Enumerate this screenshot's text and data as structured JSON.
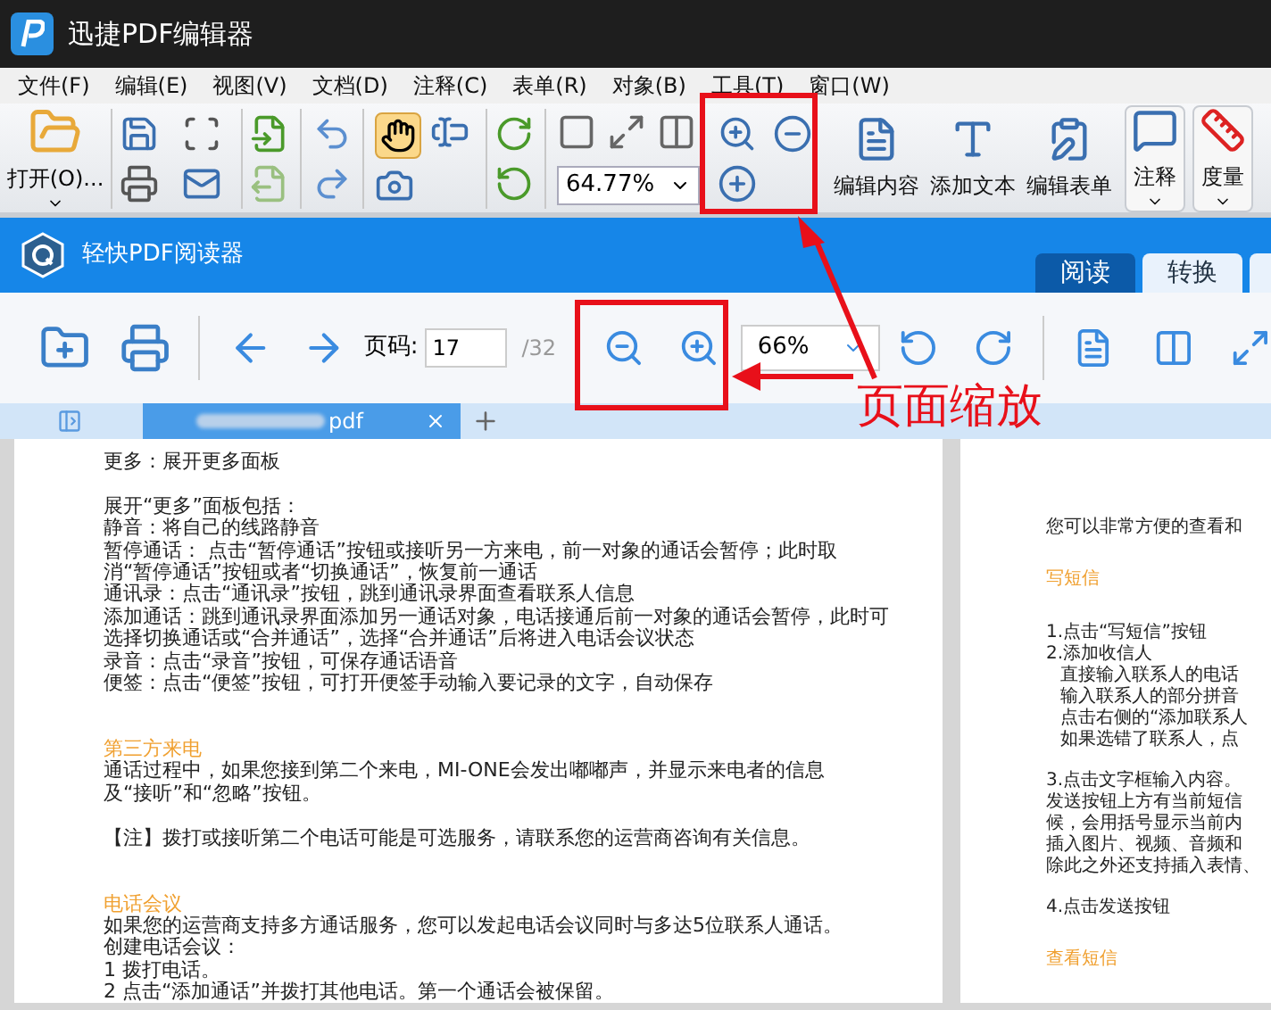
{
  "editor_window": {
    "title": "迅捷PDF编辑器",
    "menu": [
      "文件(F)",
      "编辑(E)",
      "视图(V)",
      "文档(D)",
      "注释(C)",
      "表单(R)",
      "对象(B)",
      "工具(T)",
      "窗口(W)"
    ],
    "toolbar": {
      "open_label": "打开(O)...",
      "hand_tool_selected": true,
      "zoom_value": "64.77%",
      "buttons": [
        {
          "kind": "edit-content",
          "label": "编辑内容"
        },
        {
          "kind": "add-text",
          "label": "添加文本"
        },
        {
          "kind": "edit-form",
          "label": "编辑表单"
        },
        {
          "kind": "comment",
          "label": "注释"
        },
        {
          "kind": "measure",
          "label": "度量"
        }
      ]
    }
  },
  "reader_window": {
    "title": "轻快PDF阅读器",
    "tabs": [
      {
        "label": "阅读",
        "selected": true
      },
      {
        "label": "转换",
        "selected": false
      }
    ],
    "toolbar": {
      "page_label": "页码:",
      "page_value": "17",
      "page_total": "/32",
      "zoom_value": "66%"
    },
    "document_tabs": [
      {
        "label": "pdf",
        "selected": true
      }
    ],
    "pages": [
      {
        "paragraphs": [
          {
            "kind": "text",
            "lines": [
              {
                "text": "更多：展开更多面板"
              }
            ]
          },
          {
            "kind": "text",
            "lines": [
              {
                "text": "展开“更多”面板包括："
              },
              {
                "text": "静音：将自己的线路静音"
              },
              {
                "text": "暂停通话： 点击“暂停通话”按钮或接听另一方来电，前一对象的通话会暂停；此时取"
              },
              {
                "text": "消“暂停通话”按钮或者“切换通话”，恢复前一通话"
              },
              {
                "text": "通讯录：点击“通讯录”按钮，跳到通讯录界面查看联系人信息"
              },
              {
                "text": "添加通话：跳到通讯录界面添加另一通话对象，电话接通后前一对象的通话会暂停，此时可"
              },
              {
                "text": "选择切换通话或“合并通话”，选择“合并通话”后将进入电话会议状态"
              },
              {
                "text": "录音：点击“录音”按钮，可保存通话语音"
              },
              {
                "text": "便签：点击“便签”按钮，可打开便签手动输入要记录的文字，自动保存"
              }
            ]
          },
          {
            "kind": "heading",
            "lines": [
              {
                "text": "第三方来电"
              }
            ]
          },
          {
            "kind": "text",
            "lines": [
              {
                "text": "通话过程中，如果您接到第二个来电，MI-ONE会发出嘟嘟声，并显示来电者的信息"
              },
              {
                "text": "及“接听”和“忽略”按钮。"
              }
            ]
          },
          {
            "kind": "text",
            "lines": [
              {
                "text": "【注】拨打或接听第二个电话可能是可选服务，请联系您的运营商咨询有关信息。"
              }
            ]
          },
          {
            "kind": "heading",
            "lines": [
              {
                "text": "电话会议"
              }
            ]
          },
          {
            "kind": "text",
            "lines": [
              {
                "text": "如果您的运营商支持多方通话服务，您可以发起电话会议同时与多达5位联系人通话。"
              },
              {
                "text": "创建电话会议："
              },
              {
                "text": "1 拨打电话。"
              },
              {
                "text": "2 点击“添加通话”并拨打其他电话。第一个通话会被保留。"
              }
            ]
          }
        ]
      },
      {
        "paragraphs": [
          {
            "kind": "text",
            "lines": [
              {
                "text": "您可以非常方便的查看和"
              }
            ]
          },
          {
            "kind": "heading",
            "lines": [
              {
                "text": "写短信"
              }
            ]
          },
          {
            "kind": "text",
            "lines": [
              {
                "text": "1.点击“写短信”按钮"
              },
              {
                "text": "2.添加收信人",
                "children": [
                  {
                    "text": "直接输入联系人的电话"
                  },
                  {
                    "text": "输入联系人的部分拼音"
                  },
                  {
                    "text": "点击右侧的“添加联系人"
                  },
                  {
                    "text": "如果选错了联系人，点"
                  }
                ]
              }
            ]
          },
          {
            "kind": "text",
            "lines": [
              {
                "text": "3.点击文字框输入内容。"
              },
              {
                "text": "发送按钮上方有当前短信"
              },
              {
                "text": "候，会用括号显示当前内"
              },
              {
                "text": "插入图片、视频、音频和"
              },
              {
                "text": "除此之外还支持插入表情、"
              }
            ]
          },
          {
            "kind": "text",
            "lines": [
              {
                "text": "4.点击发送按钮"
              }
            ]
          },
          {
            "kind": "heading",
            "lines": [
              {
                "text": "查看短信"
              }
            ]
          }
        ]
      }
    ]
  },
  "annotation": {
    "label": "页面缩放"
  }
}
